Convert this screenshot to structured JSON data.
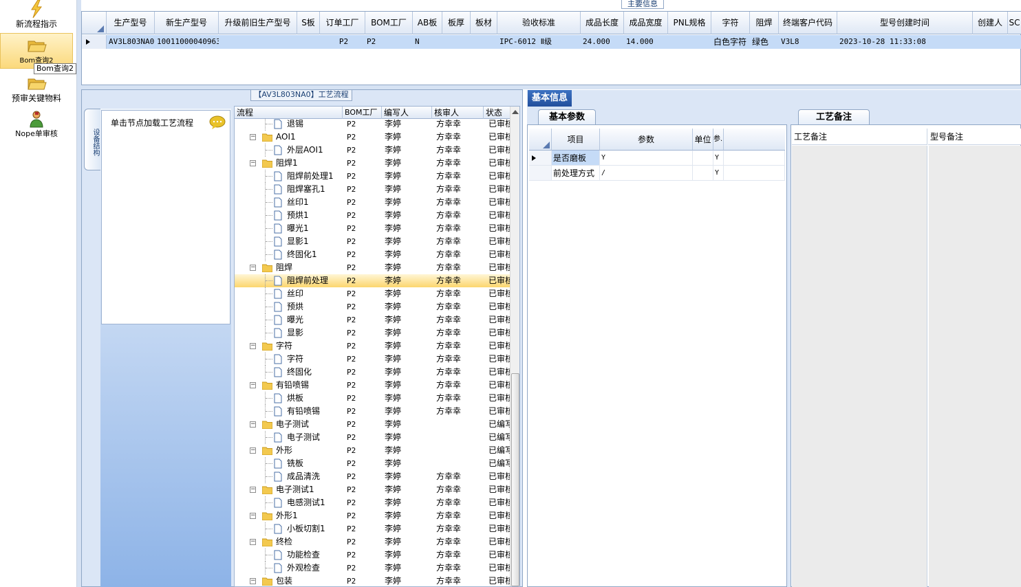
{
  "nav": {
    "items": [
      {
        "label": "新流程指示",
        "icon": "lightning-icon"
      },
      {
        "label": "Bom查询2",
        "icon": "folder-open-icon"
      },
      {
        "label": "预审关键物料",
        "icon": "folder-open-icon"
      },
      {
        "label": "Nope单审核",
        "icon": "user-icon"
      }
    ],
    "tooltip": "Bom查询2"
  },
  "main_info": {
    "tab_label": "主要信息",
    "columns": [
      "生产型号",
      "新生产型号",
      "升级前旧生产型号",
      "S板",
      "订单工厂",
      "BOM工厂",
      "AB板",
      "板厚",
      "板材",
      "验收标准",
      "成品长度",
      "成品宽度",
      "PNL规格",
      "字符",
      "阻焊",
      "终端客户代码",
      "型号创建时间",
      "创建人",
      "SC"
    ],
    "row": {
      "生产型号": "AV3L803NA0",
      "新生产型号": "10011000040963",
      "升级前旧生产型号": "",
      "S板": "",
      "订单工厂": "P2",
      "BOM工厂": "P2",
      "AB板": "N",
      "板厚": "",
      "板材": "",
      "验收标准": "IPC-6012 Ⅱ级",
      "成品长度": "24.000",
      "成品宽度": "14.000",
      "PNL规格": "",
      "字符": "白色字符",
      "阻焊": "绿色",
      "终端客户代码": "V3L8",
      "型号创建时间": "2023-10-28 11:33:08",
      "创建人": "",
      "SC": ""
    }
  },
  "process": {
    "title": "【AV3L803NA0】工艺流程",
    "side_tab": "设备结构",
    "load_hint": "单击节点加载工艺流程",
    "columns": [
      "流程",
      "BOM工厂",
      "编写人",
      "核审人",
      "状态"
    ],
    "rows": [
      {
        "level": 1,
        "name": "退锡",
        "factory": "P2",
        "writer": "李婷",
        "reviewer": "方幸幸",
        "status": "已审核"
      },
      {
        "level": 0,
        "name": "AOI1",
        "factory": "P2",
        "writer": "李婷",
        "reviewer": "方幸幸",
        "status": "已审核"
      },
      {
        "level": 1,
        "name": "外层AOI1",
        "factory": "P2",
        "writer": "李婷",
        "reviewer": "方幸幸",
        "status": "已审核"
      },
      {
        "level": 0,
        "name": "阻焊1",
        "factory": "P2",
        "writer": "李婷",
        "reviewer": "方幸幸",
        "status": "已审核"
      },
      {
        "level": 1,
        "name": "阻焊前处理1",
        "factory": "P2",
        "writer": "李婷",
        "reviewer": "方幸幸",
        "status": "已审核"
      },
      {
        "level": 1,
        "name": "阻焊塞孔1",
        "factory": "P2",
        "writer": "李婷",
        "reviewer": "方幸幸",
        "status": "已审核"
      },
      {
        "level": 1,
        "name": "丝印1",
        "factory": "P2",
        "writer": "李婷",
        "reviewer": "方幸幸",
        "status": "已审核"
      },
      {
        "level": 1,
        "name": "预烘1",
        "factory": "P2",
        "writer": "李婷",
        "reviewer": "方幸幸",
        "status": "已审核"
      },
      {
        "level": 1,
        "name": "曝光1",
        "factory": "P2",
        "writer": "李婷",
        "reviewer": "方幸幸",
        "status": "已审核"
      },
      {
        "level": 1,
        "name": "显影1",
        "factory": "P2",
        "writer": "李婷",
        "reviewer": "方幸幸",
        "status": "已审核"
      },
      {
        "level": 1,
        "name": "终固化1",
        "factory": "P2",
        "writer": "李婷",
        "reviewer": "方幸幸",
        "status": "已审核"
      },
      {
        "level": 0,
        "name": "阻焊",
        "factory": "P2",
        "writer": "李婷",
        "reviewer": "方幸幸",
        "status": "已审核"
      },
      {
        "level": 1,
        "name": "阻焊前处理",
        "factory": "P2",
        "writer": "李婷",
        "reviewer": "方幸幸",
        "status": "已审核",
        "selected": true
      },
      {
        "level": 1,
        "name": "丝印",
        "factory": "P2",
        "writer": "李婷",
        "reviewer": "方幸幸",
        "status": "已审核"
      },
      {
        "level": 1,
        "name": "预烘",
        "factory": "P2",
        "writer": "李婷",
        "reviewer": "方幸幸",
        "status": "已审核"
      },
      {
        "level": 1,
        "name": "曝光",
        "factory": "P2",
        "writer": "李婷",
        "reviewer": "方幸幸",
        "status": "已审核"
      },
      {
        "level": 1,
        "name": "显影",
        "factory": "P2",
        "writer": "李婷",
        "reviewer": "方幸幸",
        "status": "已审核"
      },
      {
        "level": 0,
        "name": "字符",
        "factory": "P2",
        "writer": "李婷",
        "reviewer": "方幸幸",
        "status": "已审核"
      },
      {
        "level": 1,
        "name": "字符",
        "factory": "P2",
        "writer": "李婷",
        "reviewer": "方幸幸",
        "status": "已审核"
      },
      {
        "level": 1,
        "name": "终固化",
        "factory": "P2",
        "writer": "李婷",
        "reviewer": "方幸幸",
        "status": "已审核"
      },
      {
        "level": 0,
        "name": "有铅喷锡",
        "factory": "P2",
        "writer": "李婷",
        "reviewer": "方幸幸",
        "status": "已审核"
      },
      {
        "level": 1,
        "name": "烘板",
        "factory": "P2",
        "writer": "李婷",
        "reviewer": "方幸幸",
        "status": "已审核"
      },
      {
        "level": 1,
        "name": "有铅喷锡",
        "factory": "P2",
        "writer": "李婷",
        "reviewer": "方幸幸",
        "status": "已审核"
      },
      {
        "level": 0,
        "name": "电子测试",
        "factory": "P2",
        "writer": "李婷",
        "reviewer": "",
        "status": "已编写"
      },
      {
        "level": 1,
        "name": "电子测试",
        "factory": "P2",
        "writer": "李婷",
        "reviewer": "",
        "status": "已编写"
      },
      {
        "level": 0,
        "name": "外形",
        "factory": "P2",
        "writer": "李婷",
        "reviewer": "",
        "status": "已编写"
      },
      {
        "level": 1,
        "name": "铣板",
        "factory": "P2",
        "writer": "李婷",
        "reviewer": "",
        "status": "已编写"
      },
      {
        "level": 1,
        "name": "成品清洗",
        "factory": "P2",
        "writer": "李婷",
        "reviewer": "方幸幸",
        "status": "已审核"
      },
      {
        "level": 0,
        "name": "电子测试1",
        "factory": "P2",
        "writer": "李婷",
        "reviewer": "方幸幸",
        "status": "已审核"
      },
      {
        "level": 1,
        "name": "电感测试1",
        "factory": "P2",
        "writer": "李婷",
        "reviewer": "方幸幸",
        "status": "已审核"
      },
      {
        "level": 0,
        "name": "外形1",
        "factory": "P2",
        "writer": "李婷",
        "reviewer": "方幸幸",
        "status": "已审核"
      },
      {
        "level": 1,
        "name": "小板切割1",
        "factory": "P2",
        "writer": "李婷",
        "reviewer": "方幸幸",
        "status": "已审核"
      },
      {
        "level": 0,
        "name": "终检",
        "factory": "P2",
        "writer": "李婷",
        "reviewer": "方幸幸",
        "status": "已审核"
      },
      {
        "level": 1,
        "name": "功能检查",
        "factory": "P2",
        "writer": "李婷",
        "reviewer": "方幸幸",
        "status": "已审核"
      },
      {
        "level": 1,
        "name": "外观检查",
        "factory": "P2",
        "writer": "李婷",
        "reviewer": "方幸幸",
        "status": "已审核"
      },
      {
        "level": 0,
        "name": "包装",
        "factory": "P2",
        "writer": "李婷",
        "reviewer": "方幸幸",
        "status": "已审核"
      }
    ]
  },
  "basic": {
    "tab_label": "基本信息",
    "params_tab": "基本参数",
    "columns": [
      "项目",
      "参数",
      "单位",
      "参.."
    ],
    "rows": [
      {
        "item": "是否磨板",
        "param": "Y",
        "unit": "",
        "flag": "Y"
      },
      {
        "item": "前处理方式",
        "param": "/",
        "unit": "",
        "flag": "Y"
      }
    ],
    "notes_tab": "工艺备注",
    "note_col1": "工艺备注",
    "note_col2": "型号备注"
  },
  "colors": {
    "selected_row": "#c5dbf7",
    "tree_selected": "#fcd66e",
    "accent_tab": "#2a5aa8",
    "panel_bg": "#dbe6f6"
  }
}
